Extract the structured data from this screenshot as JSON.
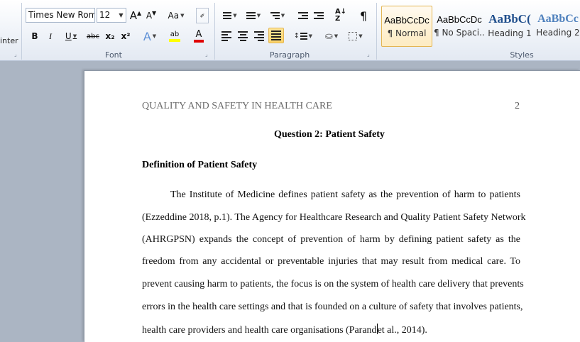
{
  "ribbon": {
    "clipboard": {
      "painter_label": "inter"
    },
    "font": {
      "group_label": "Font",
      "font_name": "Times New Rom",
      "font_size": "12",
      "grow_label": "A",
      "shrink_label": "A",
      "case_label": "Aa",
      "bold_label": "B",
      "italic_label": "I",
      "underline_label": "U",
      "strike_label": "abc",
      "subscript_label": "x₂",
      "superscript_label": "x²",
      "effects_label": "A",
      "highlight_label": "ab",
      "color_label": "A"
    },
    "paragraph": {
      "group_label": "Paragraph",
      "pilcrow": "¶"
    },
    "styles": {
      "group_label": "Styles",
      "items": [
        {
          "sample": "AaBbCcDc",
          "name": "¶ Normal"
        },
        {
          "sample": "AaBbCcDc",
          "name": "¶ No Spaci..."
        },
        {
          "sample": "AaBbC(",
          "name": "Heading 1"
        },
        {
          "sample": "AaBbCc",
          "name": "Heading 2"
        }
      ]
    }
  },
  "document": {
    "running_head": "QUALITY AND SAFETY IN HEALTH CARE",
    "page_number": "2",
    "title": "Question 2: Patient Safety",
    "subheading": "Definition of Patient Safety",
    "paragraph_lines": [
      "The Institute of Medicine defines patient safety as the prevention of harm to patients",
      "(Ezzeddine 2018, p.1). The Agency for Healthcare Research and Quality Patient Safety Network",
      "(AHRGPSN) expands the concept of prevention of harm by defining patient safety as the",
      "freedom from any accidental or preventable injuries that may result from medical care. To",
      "prevent causing harm to patients, the focus is on the system of health care delivery that prevents",
      "errors in the health care settings and that is founded on a culture of safety that involves patients,"
    ],
    "last_line_before_cursor": "health care providers and health care organisations (Parand",
    "last_line_after_cursor": "et al., 2014)."
  }
}
